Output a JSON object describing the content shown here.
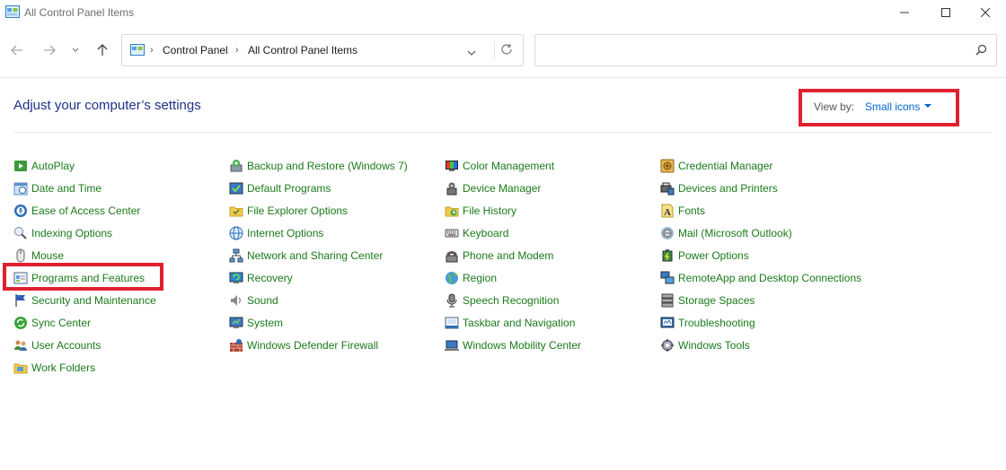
{
  "window": {
    "title": "All Control Panel Items"
  },
  "address": {
    "crumbs": [
      "Control Panel",
      "All Control Panel Items"
    ]
  },
  "search": {
    "placeholder": ""
  },
  "header": {
    "title": "Adjust your computer’s settings",
    "view_by_label": "View by:",
    "view_by_value": "Small icons"
  },
  "colors": {
    "link": "#1a7a1a",
    "heading": "#1e3287",
    "accent": "#0066cc",
    "highlight": "#e0202f"
  },
  "columns": [
    {
      "items": [
        {
          "label": "AutoPlay",
          "icon": "autoplay-icon"
        },
        {
          "label": "Date and Time",
          "icon": "date-time-icon"
        },
        {
          "label": "Ease of Access Center",
          "icon": "ease-of-access-icon"
        },
        {
          "label": "Indexing Options",
          "icon": "indexing-icon"
        },
        {
          "label": "Mouse",
          "icon": "mouse-icon"
        },
        {
          "label": "Programs and Features",
          "icon": "programs-icon"
        },
        {
          "label": "Security and Maintenance",
          "icon": "flag-icon"
        },
        {
          "label": "Sync Center",
          "icon": "sync-icon"
        },
        {
          "label": "User Accounts",
          "icon": "users-icon"
        },
        {
          "label": "Work Folders",
          "icon": "folder-icon"
        }
      ]
    },
    {
      "items": [
        {
          "label": "Backup and Restore (Windows 7)",
          "icon": "backup-icon"
        },
        {
          "label": "Default Programs",
          "icon": "default-programs-icon"
        },
        {
          "label": "File Explorer Options",
          "icon": "folder-options-icon"
        },
        {
          "label": "Internet Options",
          "icon": "internet-icon"
        },
        {
          "label": "Network and Sharing Center",
          "icon": "network-icon"
        },
        {
          "label": "Recovery",
          "icon": "recovery-icon"
        },
        {
          "label": "Sound",
          "icon": "speaker-icon"
        },
        {
          "label": "System",
          "icon": "system-icon"
        },
        {
          "label": "Windows Defender Firewall",
          "icon": "firewall-icon"
        }
      ]
    },
    {
      "items": [
        {
          "label": "Color Management",
          "icon": "color-icon"
        },
        {
          "label": "Device Manager",
          "icon": "device-manager-icon"
        },
        {
          "label": "File History",
          "icon": "file-history-icon"
        },
        {
          "label": "Keyboard",
          "icon": "keyboard-icon"
        },
        {
          "label": "Phone and Modem",
          "icon": "phone-icon"
        },
        {
          "label": "Region",
          "icon": "globe-icon"
        },
        {
          "label": "Speech Recognition",
          "icon": "microphone-icon"
        },
        {
          "label": "Taskbar and Navigation",
          "icon": "taskbar-icon"
        },
        {
          "label": "Windows Mobility Center",
          "icon": "mobility-icon"
        }
      ]
    },
    {
      "items": [
        {
          "label": "Credential Manager",
          "icon": "vault-icon"
        },
        {
          "label": "Devices and Printers",
          "icon": "printer-icon"
        },
        {
          "label": "Fonts",
          "icon": "fonts-icon"
        },
        {
          "label": "Mail (Microsoft Outlook)",
          "icon": "mail-icon"
        },
        {
          "label": "Power Options",
          "icon": "power-icon"
        },
        {
          "label": "RemoteApp and Desktop Connections",
          "icon": "remote-icon"
        },
        {
          "label": "Storage Spaces",
          "icon": "storage-icon"
        },
        {
          "label": "Troubleshooting",
          "icon": "troubleshoot-icon"
        },
        {
          "label": "Windows Tools",
          "icon": "tools-icon"
        }
      ]
    }
  ]
}
